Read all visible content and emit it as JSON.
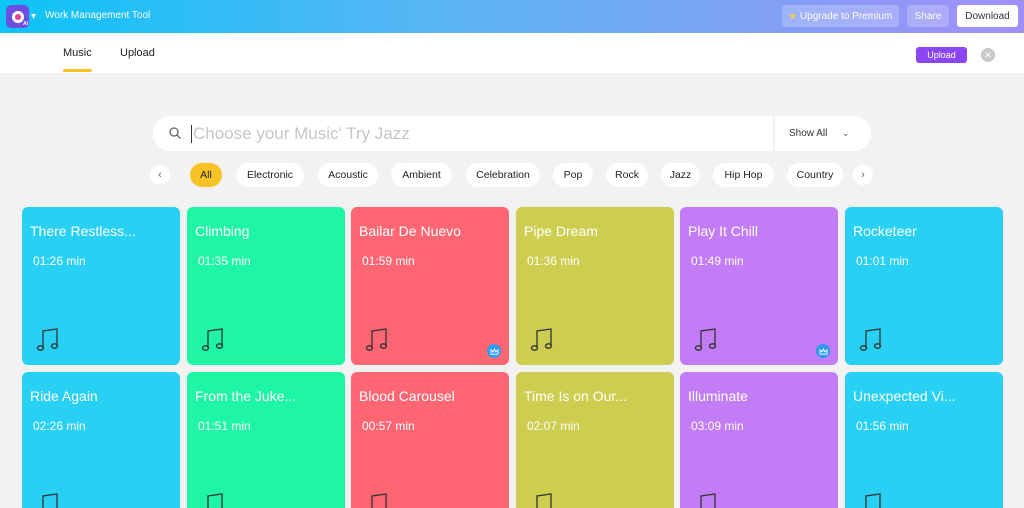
{
  "app": {
    "title": "Work Management Tool",
    "icon_badge": "AI",
    "upgrade_label": "Upgrade to Premium",
    "share_label": "Share",
    "download_label": "Download"
  },
  "tabs": {
    "music": "Music",
    "upload": "Upload",
    "active": "Music",
    "upload_button": "Upload"
  },
  "search": {
    "placeholder": "Choose your Music' Try Jazz",
    "filter_label": "Show All"
  },
  "genres": {
    "active": "All",
    "items": [
      "All",
      "Electronic",
      "Acoustic",
      "Ambient",
      "Celebration",
      "Pop",
      "Rock",
      "Jazz",
      "Hip Hop",
      "Country"
    ]
  },
  "colors": {
    "blue": "#28d1f4",
    "green": "#1ef6a6",
    "red": "#ff6673",
    "olive": "#cdcd4f",
    "purple": "#c17cf6",
    "accent_yellow": "#f7c325",
    "upload_purple": "#8a46f0",
    "premium_badge": "#2f9bf0"
  },
  "tracks": [
    {
      "title": "There Restless...",
      "duration": "01:26 min",
      "color": "blue",
      "premium": false
    },
    {
      "title": "Climbing",
      "duration": "01:35 min",
      "color": "green",
      "premium": false
    },
    {
      "title": "Bailar De Nuevo",
      "duration": "01:59 min",
      "color": "red",
      "premium": true
    },
    {
      "title": "Pipe Dream",
      "duration": "01:36 min",
      "color": "olive",
      "premium": false
    },
    {
      "title": "Play It Chill",
      "duration": "01:49 min",
      "color": "purple",
      "premium": true
    },
    {
      "title": "Rocketeer",
      "duration": "01:01 min",
      "color": "blue",
      "premium": false
    },
    {
      "title": "Ride Again",
      "duration": "02:26 min",
      "color": "blue",
      "premium": false
    },
    {
      "title": "From the Juke...",
      "duration": "01:51 min",
      "color": "green",
      "premium": false
    },
    {
      "title": "Blood Carousel",
      "duration": "00:57 min",
      "color": "red",
      "premium": false
    },
    {
      "title": "Time Is on Our...",
      "duration": "02:07 min",
      "color": "olive",
      "premium": false
    },
    {
      "title": "Illuminate",
      "duration": "03:09 min",
      "color": "purple",
      "premium": false
    },
    {
      "title": "Unexpected Vi...",
      "duration": "01:56 min",
      "color": "blue",
      "premium": false
    }
  ]
}
